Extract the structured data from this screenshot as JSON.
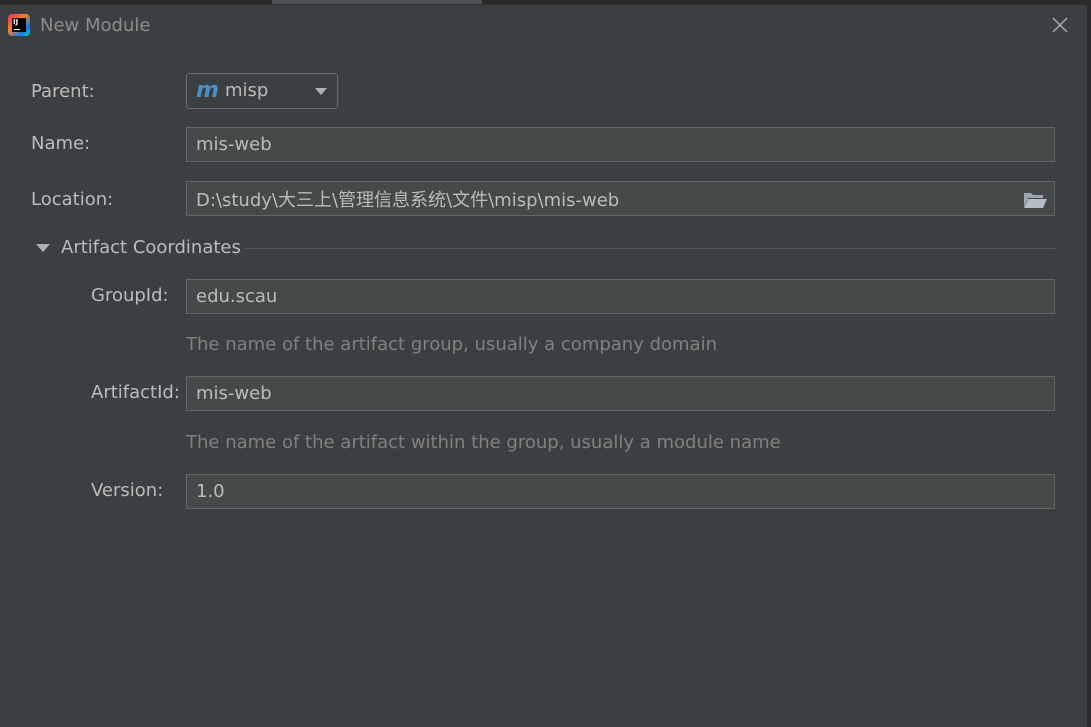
{
  "window": {
    "title": "New Module",
    "close_icon": "close-icon"
  },
  "parent": {
    "label": "Parent:",
    "value": "misp",
    "icon": "m",
    "icon_color": "#4a90c8"
  },
  "name": {
    "label": "Name:",
    "value": "mis-web"
  },
  "location": {
    "label": "Location:",
    "value": "D:\\study\\大三上\\管理信息系统\\文件\\misp\\mis-web",
    "browse_icon": "folder-open-icon"
  },
  "artifact": {
    "section_title": "Artifact Coordinates",
    "group_id": {
      "label": "GroupId:",
      "value": "edu.scau",
      "hint": "The name of the artifact group, usually a company domain"
    },
    "artifact_id": {
      "label": "ArtifactId:",
      "value": "mis-web",
      "hint": "The name of the artifact within the group, usually a module name"
    },
    "version": {
      "label": "Version:",
      "value": "1.0"
    }
  },
  "colors": {
    "background": "#3c3f41",
    "field_background": "#45494a",
    "field_border": "#646464",
    "text": "#bbbbbb",
    "hint_text": "#808080"
  }
}
